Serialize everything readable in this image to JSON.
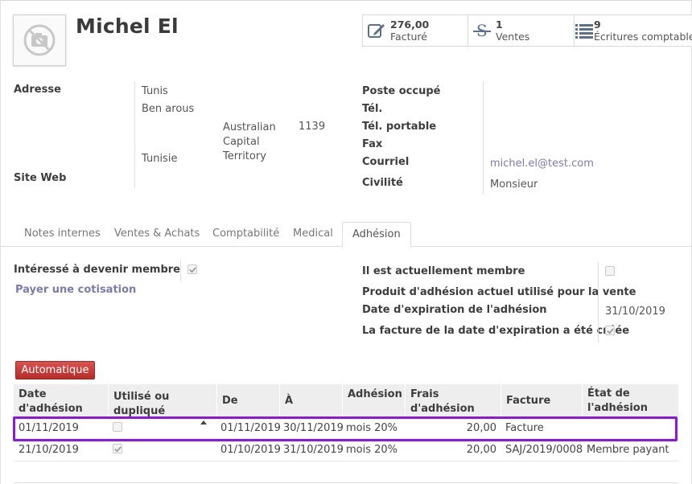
{
  "partner": {
    "name": "Michel El"
  },
  "smart_buttons": [
    {
      "value": "276,00",
      "label": "Facturé",
      "icon": "pencil-square-icon"
    },
    {
      "value": "1",
      "label": "Ventes",
      "icon": "strikethrough-s-icon"
    },
    {
      "value": "9",
      "label": "Écritures comptables",
      "icon": "list-icon"
    }
  ],
  "address": {
    "label": "Adresse",
    "city": "Tunis",
    "street": "Ben arous",
    "state": "Australian Capital Territory",
    "zip": "1139",
    "country": "Tunisie",
    "website_label": "Site Web"
  },
  "contact": {
    "job_label": "Poste occupé",
    "phone_label": "Tél.",
    "mobile_label": "Tél. portable",
    "fax_label": "Fax",
    "email_label": "Courriel",
    "email": "michel.el@test.com",
    "title_label": "Civilité",
    "title": "Monsieur"
  },
  "tabs": [
    "Notes internes",
    "Ventes & Achats",
    "Comptabilité",
    "Medical",
    "Adhésion"
  ],
  "active_tab": "Adhésion",
  "membership": {
    "interested_label": "Intéressé à devenir membre",
    "interested": true,
    "pay_link": "Payer une cotisation",
    "current_member_label": "Il est actuellement membre",
    "current_member": false,
    "product_label": "Produit d'adhésion actuel utilisé pour la vente",
    "expiry_label": "Date d'expiration de l'adhésion",
    "expiry": "31/10/2019",
    "invoice_created_label": "La facture de la date d'expiration a été créée",
    "invoice_created": true,
    "auto_button": "Automatique"
  },
  "table": {
    "headers": [
      "Date d'adhésion",
      "Utilisé ou dupliqué",
      "De",
      "À",
      "Adhésion",
      "Frais d'adhésion",
      "Facture",
      "État de l'adhésion"
    ],
    "rows": [
      {
        "date": "01/11/2019",
        "used": false,
        "from": "01/11/2019",
        "to": "30/11/2019",
        "membership": "mois 20%",
        "fee": "20,00",
        "invoice": "Facture",
        "state": ""
      },
      {
        "date": "21/10/2019",
        "used": true,
        "from": "01/10/2019",
        "to": "31/10/2019",
        "membership": "mois 20%",
        "fee": "20,00",
        "invoice": "SAJ/2019/0008",
        "state": "Membre payant"
      }
    ]
  },
  "colors": {
    "accent": "#7c7bad",
    "danger": "#c9302c",
    "highlight": "#8b17e3"
  }
}
